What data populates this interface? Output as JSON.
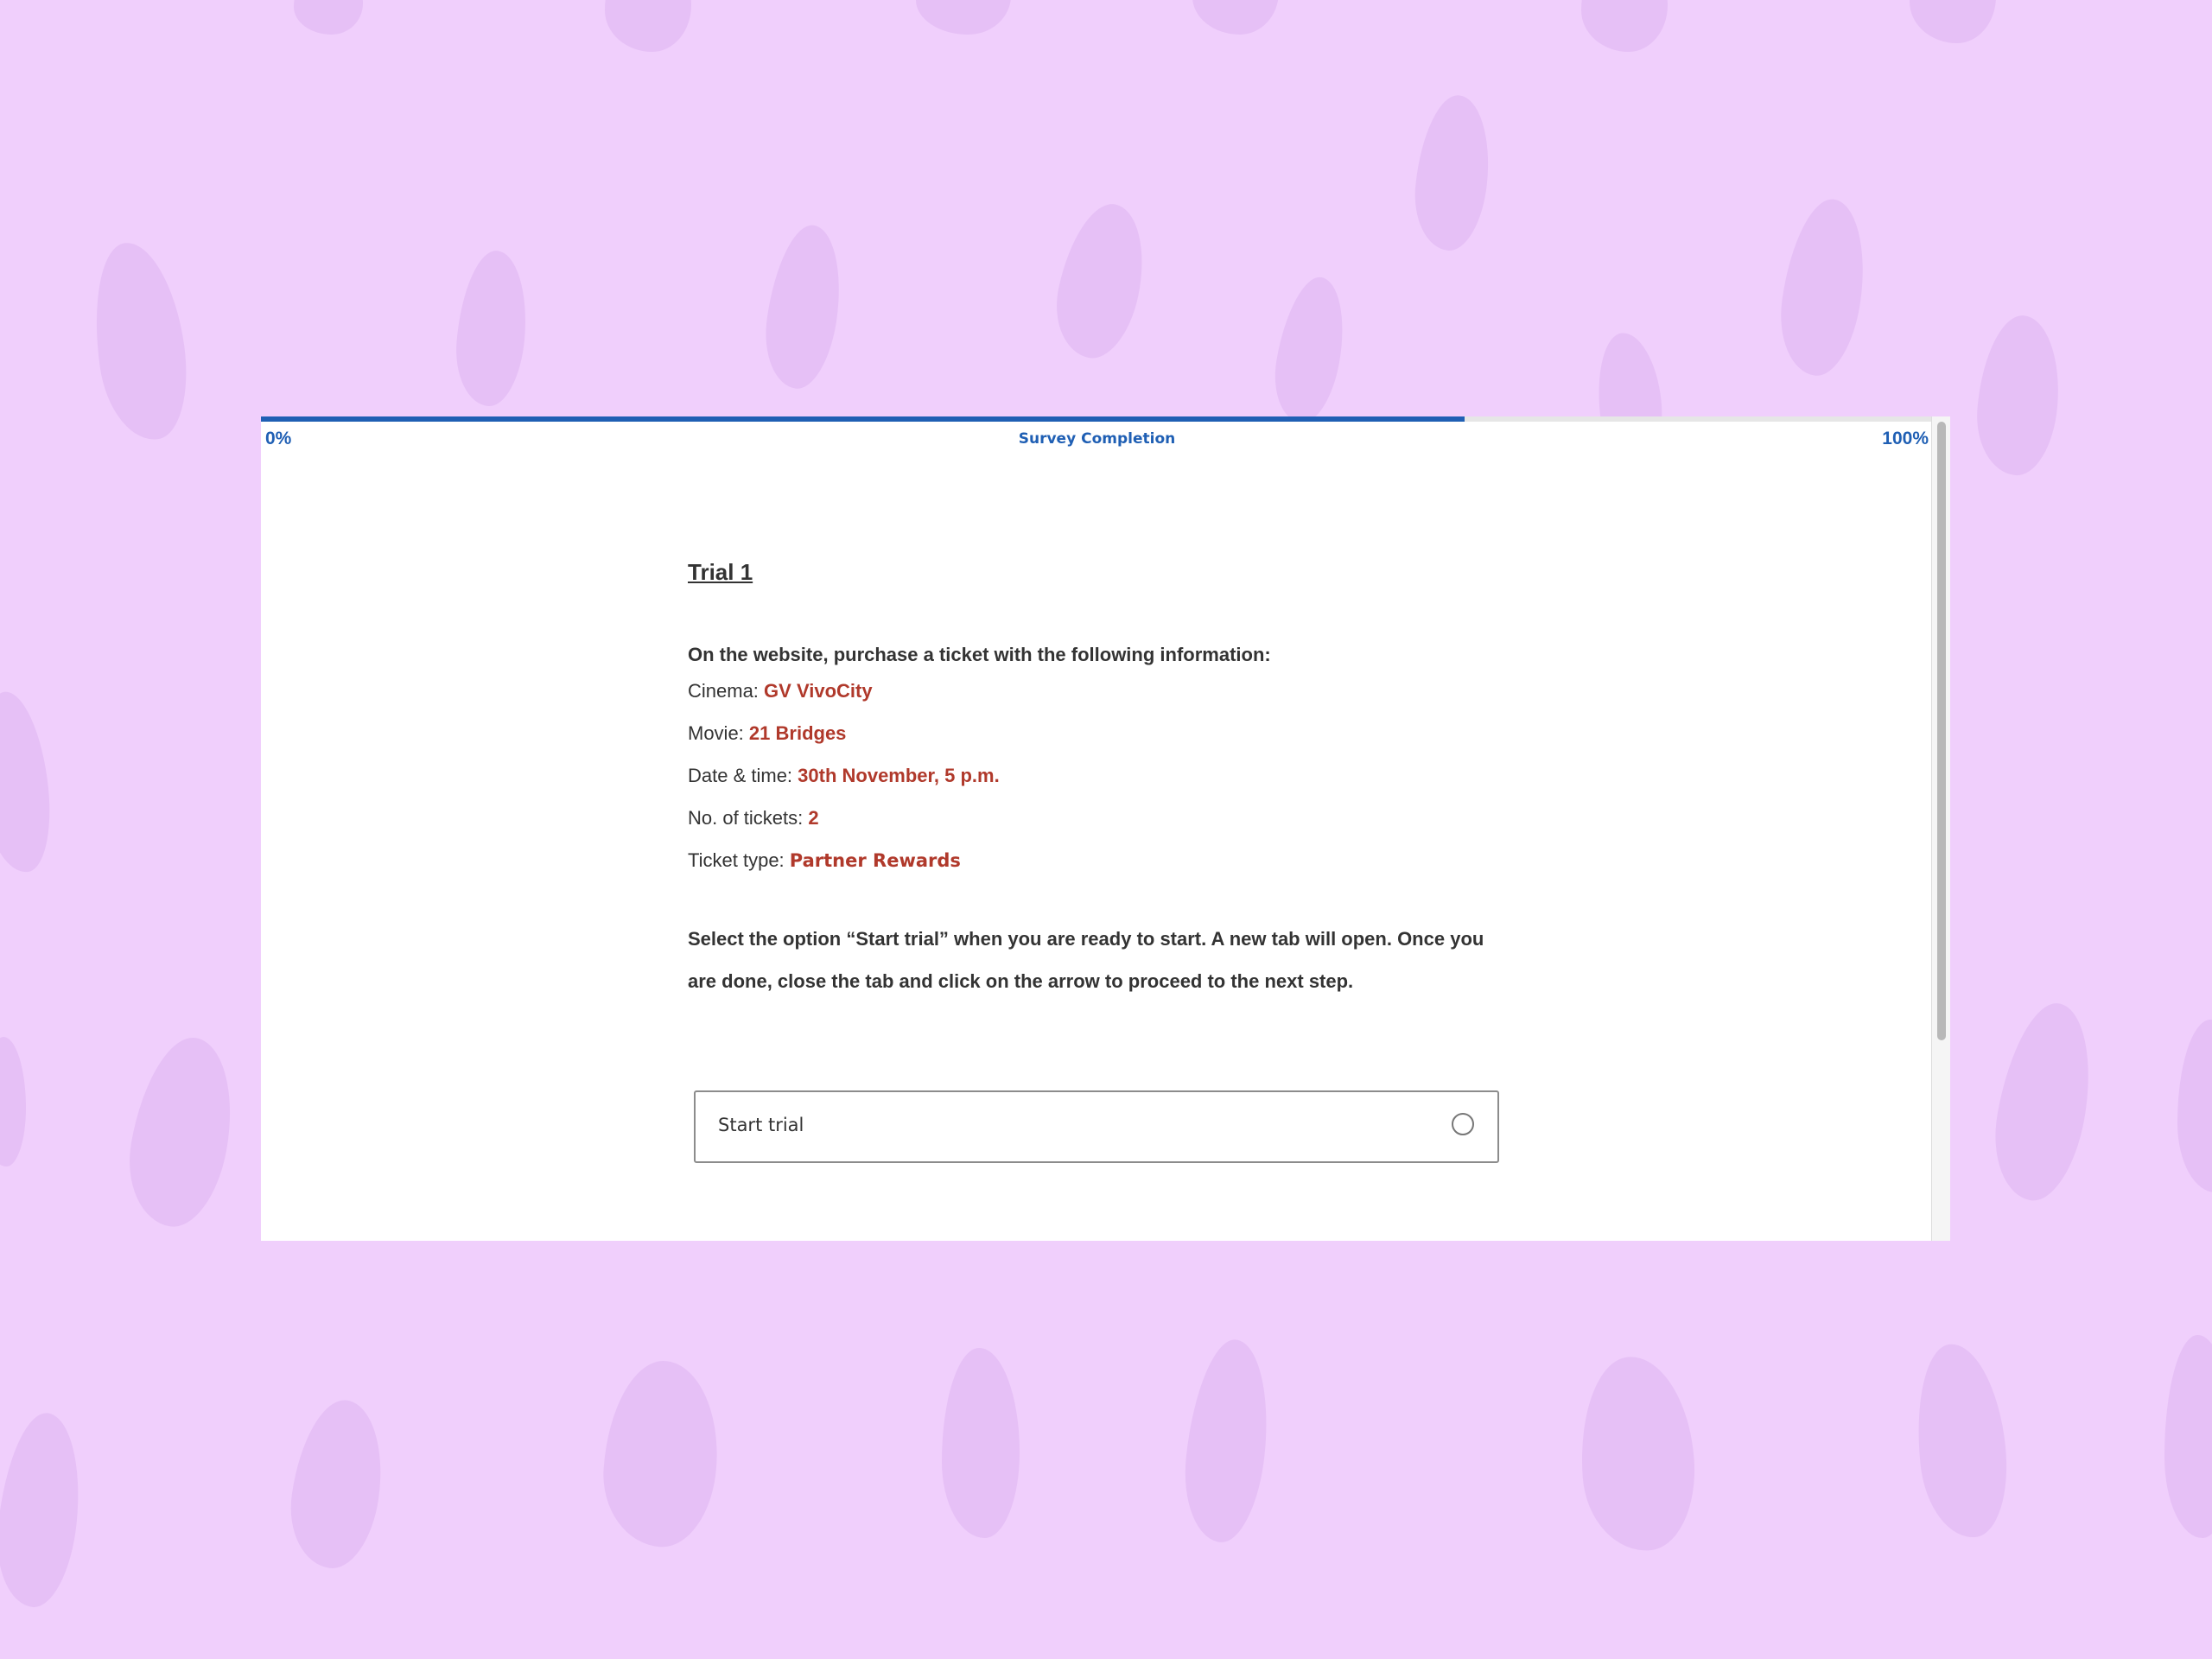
{
  "progress": {
    "start_label": "0%",
    "end_label": "100%",
    "title": "Survey Completion",
    "value_percent": 72,
    "accent_color": "#1f5fb4"
  },
  "content": {
    "title": "Trial 1",
    "intro": "On the website, purchase a ticket with the following information:",
    "fields": [
      {
        "label": "Cinema: ",
        "value": "GV VivoCity"
      },
      {
        "label": "Movie: ",
        "value": "21 Bridges"
      },
      {
        "label": "Date & time: ",
        "value": "30th November, 5 p.m."
      },
      {
        "label": "No. of tickets: ",
        "value": "2"
      },
      {
        "label": "Ticket type: ",
        "value": "Partner Rewards"
      }
    ],
    "instructions": "Select the option “Start trial” when you are ready to start. A new tab will open. Once you are done, close the tab and click on the arrow to proceed to the next step.",
    "value_color": "#b0392b"
  },
  "choice": {
    "label": "Start trial",
    "selected": false
  },
  "background_color": "#f0cffc"
}
